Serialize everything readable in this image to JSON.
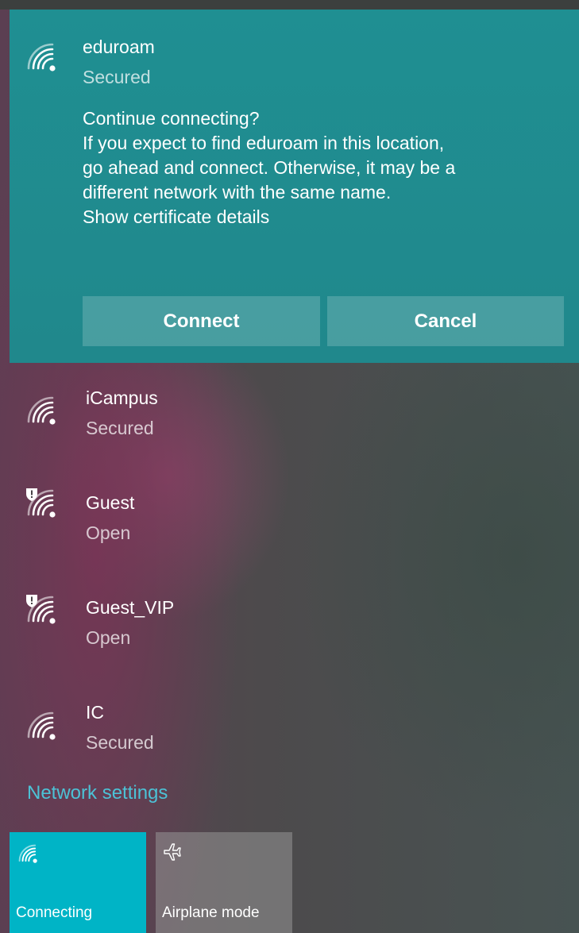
{
  "active_network": {
    "ssid": "eduroam",
    "status": "Secured",
    "icon": "wifi-signal-icon",
    "prompt_title": "Continue connecting?",
    "prompt_lines": [
      "If you expect to find eduroam in this location,",
      "go ahead and connect. Otherwise, it may be a",
      "different network with the same name."
    ],
    "certificate_link": "Show certificate details",
    "connect_label": "Connect",
    "cancel_label": "Cancel"
  },
  "networks": [
    {
      "ssid": "iCampus",
      "status": "Secured",
      "icon": "wifi-signal-icon"
    },
    {
      "ssid": "Guest",
      "status": "Open",
      "icon": "wifi-open-warning-icon"
    },
    {
      "ssid": "Guest_VIP",
      "status": "Open",
      "icon": "wifi-open-warning-icon"
    },
    {
      "ssid": "IC",
      "status": "Secured",
      "icon": "wifi-signal-icon"
    }
  ],
  "network_settings_label": "Network settings",
  "quick_actions": [
    {
      "label": "Connecting",
      "icon": "wifi-signal-icon",
      "active": true
    },
    {
      "label": "Airplane mode",
      "icon": "airplane-icon",
      "active": false
    }
  ],
  "colors": {
    "accent": "#1f8f92",
    "tile_active": "#00b4c6",
    "link": "#4cc2d6"
  }
}
